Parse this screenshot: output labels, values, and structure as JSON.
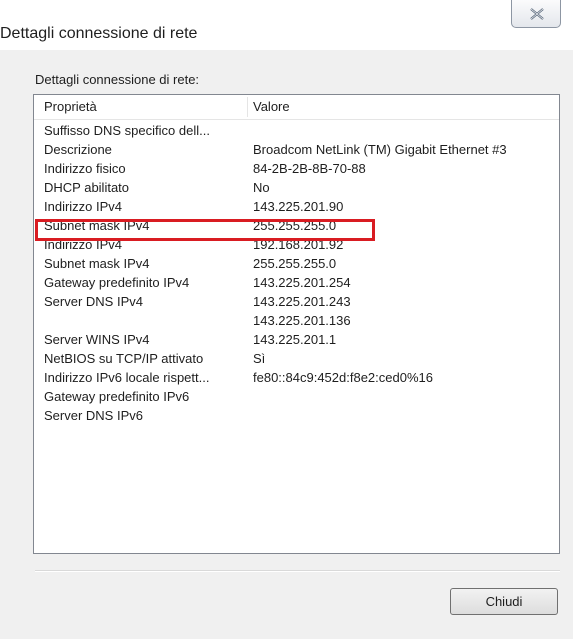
{
  "window": {
    "title": "Dettagli connessione di rete"
  },
  "group_label": "Dettagli connessione di rete:",
  "table": {
    "columns": [
      "Proprietà",
      "Valore"
    ],
    "rows": [
      {
        "property": "Suffisso DNS specifico dell...",
        "value": ""
      },
      {
        "property": "Descrizione",
        "value": "Broadcom NetLink (TM) Gigabit Ethernet #3"
      },
      {
        "property": "Indirizzo fisico",
        "value": "84-2B-2B-8B-70-88"
      },
      {
        "property": "DHCP abilitato",
        "value": "No"
      },
      {
        "property": "Indirizzo IPv4",
        "value": "143.225.201.90"
      },
      {
        "property": "Subnet mask IPv4",
        "value": "255.255.255.0"
      },
      {
        "property": "Indirizzo IPv4",
        "value": "192.168.201.92"
      },
      {
        "property": "Subnet mask IPv4",
        "value": "255.255.255.0"
      },
      {
        "property": "Gateway predefinito IPv4",
        "value": "143.225.201.254"
      },
      {
        "property": "Server DNS IPv4",
        "value": "143.225.201.243"
      },
      {
        "property": "",
        "value": "143.225.201.136"
      },
      {
        "property": "Server WINS IPv4",
        "value": "143.225.201.1"
      },
      {
        "property": "NetBIOS su TCP/IP attivato",
        "value": "Sì"
      },
      {
        "property": "Indirizzo IPv6 locale rispett...",
        "value": "fe80::84c9:452d:f8e2:ced0%16"
      },
      {
        "property": "Gateway predefinito IPv6",
        "value": ""
      },
      {
        "property": "Server DNS IPv6",
        "value": ""
      }
    ]
  },
  "buttons": {
    "close_label": "Chiudi"
  },
  "colors": {
    "highlight_border": "#d91c22",
    "list_border": "#828790"
  },
  "icons": {
    "close": "close-x-icon"
  }
}
